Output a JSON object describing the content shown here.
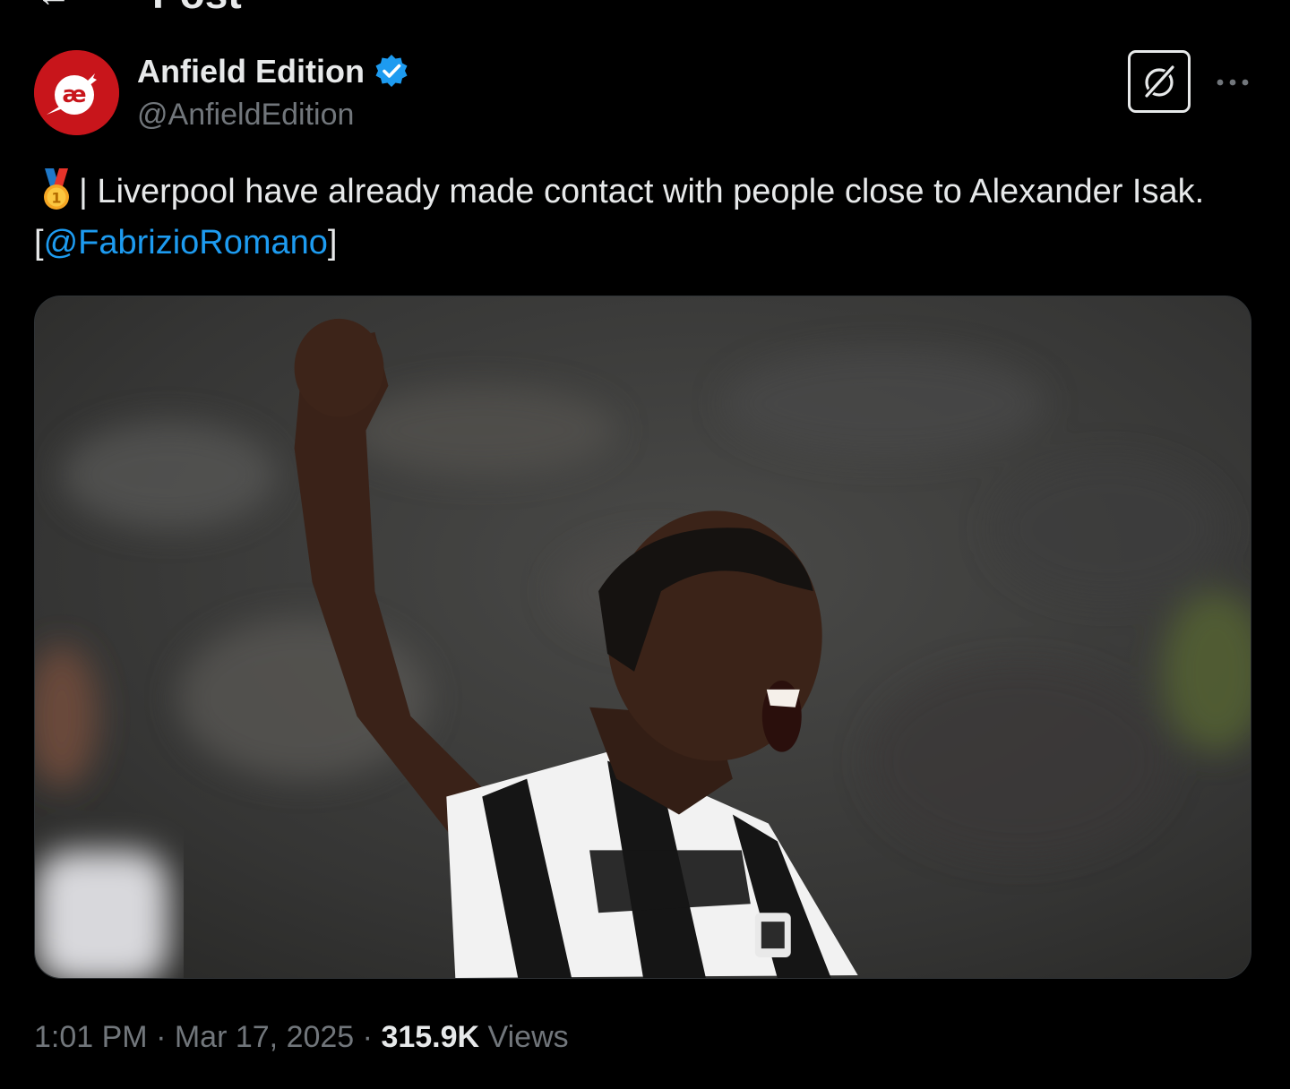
{
  "header": {
    "title": "Post"
  },
  "author": {
    "name": "Anfield Edition",
    "handle": "@AnfieldEdition",
    "avatar_text": "æ",
    "avatar_color": "#c8151b",
    "verified_color": "#1d9bf0"
  },
  "tweet": {
    "medal_icon": "first-place-medal",
    "text_main": "| Liverpool have already made contact with people close to Alexander Isak. [",
    "mention": "@FabrizioRomano",
    "text_end": "]",
    "mention_color": "#1d9bf0"
  },
  "meta": {
    "time": "1:01 PM",
    "separator": "·",
    "date": "Mar 17, 2025",
    "views_count": "315.9K",
    "views_label": "Views"
  }
}
